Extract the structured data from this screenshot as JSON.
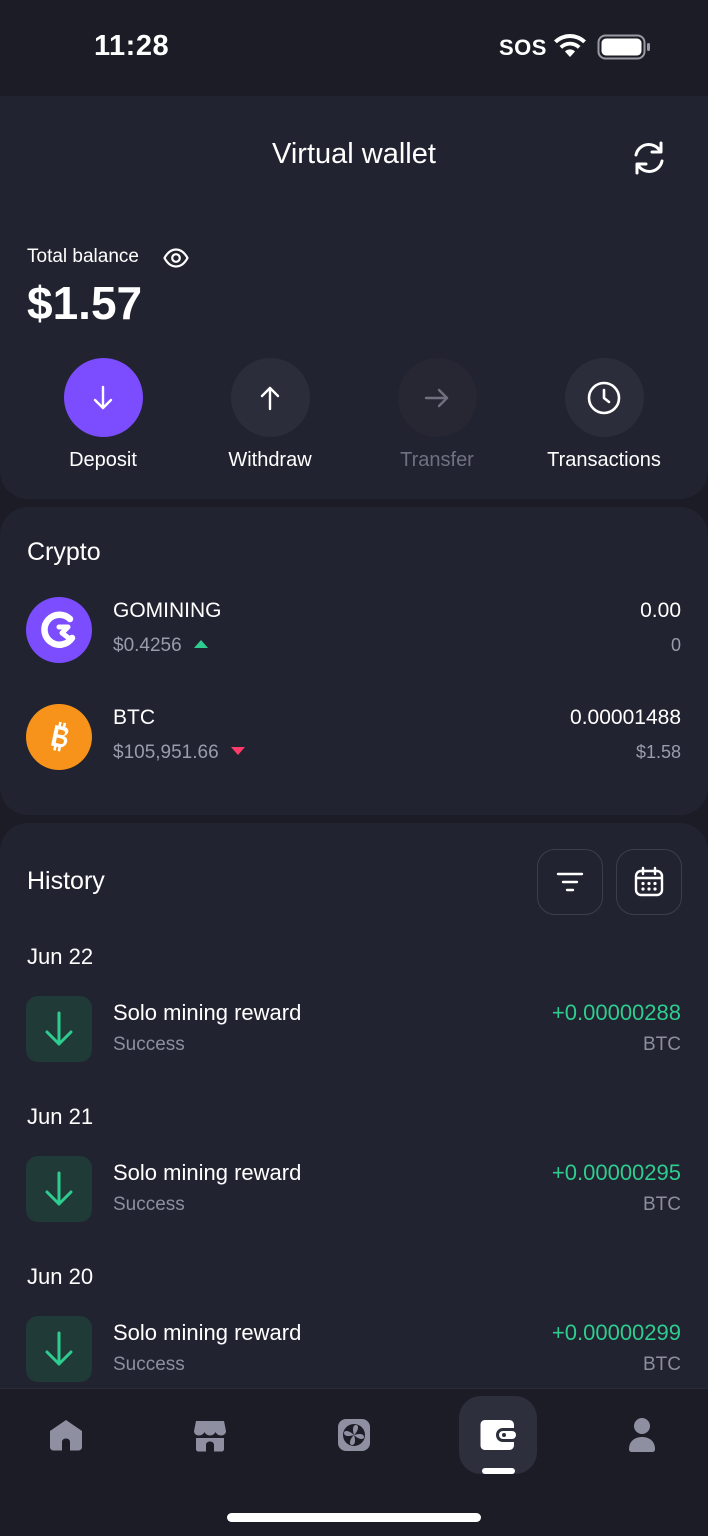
{
  "status_bar": {
    "time": "11:28",
    "carrier": "SOS"
  },
  "header": {
    "title": "Virtual wallet"
  },
  "balance": {
    "label": "Total balance",
    "amount": "$1.57"
  },
  "actions": [
    {
      "label": "Deposit",
      "icon": "arrow-down-icon",
      "state": "primary"
    },
    {
      "label": "Withdraw",
      "icon": "arrow-up-icon",
      "state": "normal"
    },
    {
      "label": "Transfer",
      "icon": "arrow-right-icon",
      "state": "disabled"
    },
    {
      "label": "Transactions",
      "icon": "clock-icon",
      "state": "normal"
    }
  ],
  "crypto": {
    "title": "Crypto",
    "items": [
      {
        "name": "GOMINING",
        "price": "$0.4256",
        "trend": "up",
        "amount": "0.00",
        "value": "0"
      },
      {
        "name": "BTC",
        "price": "$105,951.66",
        "trend": "down",
        "amount": "0.00001488",
        "value": "$1.58"
      }
    ]
  },
  "history": {
    "title": "History",
    "groups": [
      {
        "date": "Jun 22",
        "title": "Solo mining reward",
        "status": "Success",
        "amount": "+0.00000288",
        "currency": "BTC"
      },
      {
        "date": "Jun 21",
        "title": "Solo mining reward",
        "status": "Success",
        "amount": "+0.00000295",
        "currency": "BTC"
      },
      {
        "date": "Jun 20",
        "title": "Solo mining reward",
        "status": "Success",
        "amount": "+0.00000299",
        "currency": "BTC"
      }
    ]
  },
  "colors": {
    "accent": "#7c4dff",
    "positive": "#2ecc8f",
    "negative": "#ff3b6b",
    "bitcoin": "#f7931a",
    "background": "#1b1c25",
    "card": "#222330"
  },
  "nav": [
    {
      "icon": "home-icon",
      "active": false
    },
    {
      "icon": "store-icon",
      "active": false
    },
    {
      "icon": "fan-icon",
      "active": false
    },
    {
      "icon": "wallet-icon",
      "active": true
    },
    {
      "icon": "profile-icon",
      "active": false
    }
  ]
}
